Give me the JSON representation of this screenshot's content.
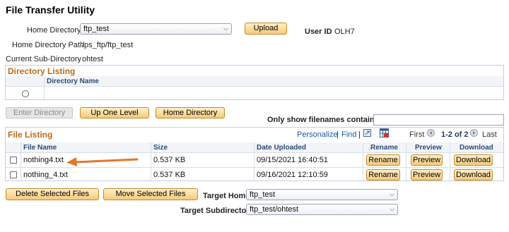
{
  "title": "File Transfer Utility",
  "home_directory": {
    "label": "Home Directory",
    "value": "ftp_test"
  },
  "upload_button": "Upload",
  "user_id": {
    "label": "User ID",
    "value": "OLH7"
  },
  "home_directory_path": {
    "label": "Home Directory Path",
    "value": "/ps_ftp/ftp_test"
  },
  "current_sub_directory": {
    "label": "Current Sub-Directory",
    "value": "ohtest"
  },
  "directory_listing": {
    "heading": "Directory Listing",
    "column": "Directory Name"
  },
  "nav_buttons": {
    "enter_directory": "Enter Directory",
    "up_one_level": "Up One Level",
    "home_directory": "Home Directory"
  },
  "filter": {
    "label": "Only show filenames containing",
    "value": ""
  },
  "file_listing": {
    "heading": "File Listing",
    "personalize": "Personalize",
    "sep1": "|",
    "find": "Find",
    "sep2": "|",
    "first": "First",
    "range": "1-2 of 2",
    "last": "Last",
    "columns": {
      "file_name": "File Name",
      "size": "Size",
      "date_uploaded": "Date Uploaded",
      "rename": "Rename",
      "preview": "Preview",
      "download": "Download"
    },
    "rows": [
      {
        "file_name": "nothing4.txt",
        "size": "0.537 KB",
        "date": "09/15/2021 16:40:51",
        "rename": "Rename",
        "preview": "Preview",
        "download": "Download"
      },
      {
        "file_name": "nothing_4.txt",
        "size": "0.537 KB",
        "date": "09/16/2021 12:10:59",
        "rename": "Rename",
        "preview": "Preview",
        "download": "Download"
      }
    ]
  },
  "bottom": {
    "delete_selected": "Delete Selected Files",
    "move_selected": "Move Selected Files",
    "target_home": {
      "label": "Target Home",
      "value": "ftp_test"
    },
    "target_subdirectory": {
      "label": "Target Subdirectory",
      "value": "ftp_test/ohtest"
    }
  },
  "colors": {
    "accent": "#c06b17",
    "button": "#f7c97a",
    "link": "#1e5aa8",
    "arrow": "#e07a2a"
  },
  "icons": [
    "chevron-down-icon",
    "grid-view-icon",
    "download-excel-icon",
    "arrow-left-icon",
    "arrow-right-icon",
    "annotation-arrow-icon"
  ]
}
